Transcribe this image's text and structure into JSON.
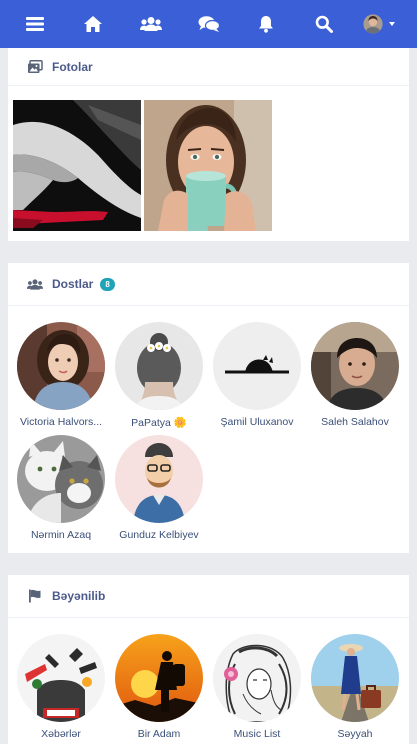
{
  "nav": {
    "items": [
      "menu",
      "home",
      "friends",
      "messages",
      "notifications",
      "search",
      "profile"
    ]
  },
  "photos": {
    "title": "Fotolar"
  },
  "friends": {
    "title": "Dostlar",
    "count": "8",
    "items": [
      {
        "name": "Victoria Halvors..."
      },
      {
        "name": "PaPatya 🌼"
      },
      {
        "name": "Şamil Uluxanov"
      },
      {
        "name": "Saleh Salahov"
      },
      {
        "name": "Nərmin Azaq"
      },
      {
        "name": "Gunduz Kelbiyev"
      }
    ]
  },
  "liked": {
    "title": "Bəyənilib",
    "items": [
      {
        "name": "Xəbərlər"
      },
      {
        "name": "Bir Adam"
      },
      {
        "name": "Music List"
      },
      {
        "name": "Səyyah"
      }
    ]
  },
  "colors": {
    "navbar": "#3b5fd6",
    "badge": "#1fa3b8",
    "title": "#4b5a8a",
    "name": "#3a4f78"
  }
}
